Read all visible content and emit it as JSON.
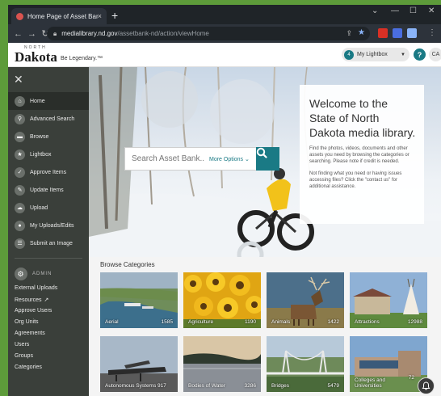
{
  "browser": {
    "tab_title": "Home Page of Asset Bank",
    "tab_close": "×",
    "new_tab": "+",
    "url_host": "medialibrary.nd.gov",
    "url_path": "/assetbank-nd/action/viewHome",
    "minimize": "—",
    "restore": "☐",
    "close": "✕",
    "chevron": "⌄"
  },
  "header": {
    "logo_north": "NORTH",
    "logo_dakota": "Dakota",
    "logo_tagline": "Be Legendary.™",
    "lightbox_count": "4",
    "lightbox_label": "My Lightbox",
    "help": "?",
    "avatar_initials": "CA"
  },
  "sidebar": {
    "close": "✕",
    "items": [
      {
        "label": "Home",
        "icon": "home-icon"
      },
      {
        "label": "Advanced Search",
        "icon": "search-icon"
      },
      {
        "label": "Browse",
        "icon": "folder-icon"
      },
      {
        "label": "Lightbox",
        "icon": "star-icon"
      },
      {
        "label": "Approve Items",
        "icon": "check-icon"
      },
      {
        "label": "Update Items",
        "icon": "pencil-icon"
      },
      {
        "label": "Upload",
        "icon": "cloud-upload-icon"
      },
      {
        "label": "My Uploads/Edits",
        "icon": "user-icon"
      },
      {
        "label": "Submit an Image",
        "icon": "list-icon"
      }
    ],
    "admin_label": "ADMIN",
    "admin_links": [
      "External Uploads",
      "Resources",
      "Approve Users",
      "Org Units",
      "Agreements",
      "Users",
      "Groups",
      "Categories"
    ]
  },
  "search": {
    "placeholder": "Search Asset Bank...",
    "more_options": "More Options"
  },
  "welcome": {
    "heading": "Welcome to the State of North Dakota media library.",
    "para1": "Find the photos, videos, documents and other assets you need by browsing the categories or searching. Please note if credit is needed.",
    "para2": "Not finding what you need or having issues accessing files? Click the \"contact us\" for additional assistance."
  },
  "browse": {
    "title": "Browse Categories",
    "categories": [
      {
        "label": "Aerial",
        "count": "1585"
      },
      {
        "label": "Agriculture",
        "count": "1190"
      },
      {
        "label": "Animals",
        "count": "1422"
      },
      {
        "label": "Attractions",
        "count": "12988"
      },
      {
        "label": "Autonomous Systems",
        "count": "917"
      },
      {
        "label": "Bodies of Water",
        "count": "3286"
      },
      {
        "label": "Bridges",
        "count": "5479"
      },
      {
        "label": "Colleges and Universities",
        "count": "72"
      }
    ]
  },
  "colors": {
    "accent": "#1a7a85",
    "sidebar": "#3a3f3a",
    "desktop": "#5d9b3a"
  }
}
